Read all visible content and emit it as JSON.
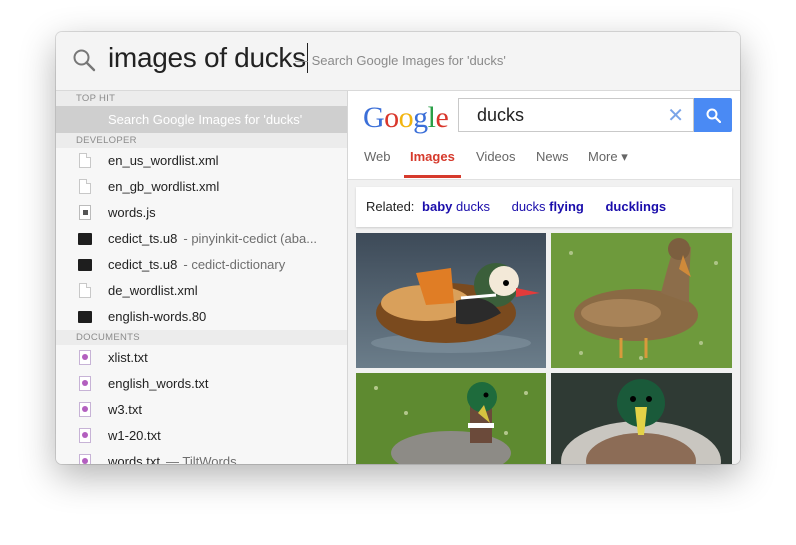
{
  "search": {
    "query": "images of ducks",
    "hint": "— Search Google Images for 'ducks'"
  },
  "sections": {
    "top_hit": "TOP HIT",
    "developer": "DEVELOPER",
    "documents": "DOCUMENTS"
  },
  "top_hit": {
    "label": "Search Google Images for 'ducks'"
  },
  "developer_items": [
    {
      "name": "en_us_wordlist.xml",
      "sub": "",
      "icon": "document-icon"
    },
    {
      "name": "en_gb_wordlist.xml",
      "sub": "",
      "icon": "document-icon"
    },
    {
      "name": "words.js",
      "sub": "",
      "icon": "javascript-file-icon"
    },
    {
      "name": "cedict_ts.u8",
      "sub": "- pinyinkit-cedict (aba...",
      "icon": "terminal-icon"
    },
    {
      "name": "cedict_ts.u8",
      "sub": "- cedict-dictionary",
      "icon": "terminal-icon"
    },
    {
      "name": "de_wordlist.xml",
      "sub": "",
      "icon": "document-icon"
    },
    {
      "name": "english-words.80",
      "sub": "",
      "icon": "terminal-icon"
    }
  ],
  "document_items": [
    {
      "name": "xlist.txt",
      "sub": "",
      "icon": "text-file-icon"
    },
    {
      "name": "english_words.txt",
      "sub": "",
      "icon": "text-file-icon"
    },
    {
      "name": "w3.txt",
      "sub": "",
      "icon": "text-file-icon"
    },
    {
      "name": "w1-20.txt",
      "sub": "",
      "icon": "text-file-icon"
    },
    {
      "name": "words.txt",
      "sub": "— TiltWords",
      "icon": "text-file-icon"
    }
  ],
  "google": {
    "logo": [
      "G",
      "o",
      "o",
      "g",
      "l",
      "e"
    ],
    "search_value": "ducks",
    "clear_glyph": "✕",
    "tabs": [
      "Web",
      "Images",
      "Videos",
      "News",
      "More ▾"
    ],
    "active_tab": "Images",
    "related_label": "Related:",
    "related": [
      {
        "bold": "baby",
        "plain": " ducks"
      },
      {
        "plain": "ducks ",
        "bold": "flying"
      },
      {
        "bold": "ducklings",
        "plain": ""
      }
    ],
    "images": [
      "mandarin-duck-on-water",
      "female-mallard-on-grass",
      "male-mallard-on-grass",
      "mallard-front-view-on-water"
    ]
  },
  "colors": {
    "accent_blue": "#4a8af4",
    "tab_active": "#d63a2c",
    "link": "#1a0dab"
  }
}
